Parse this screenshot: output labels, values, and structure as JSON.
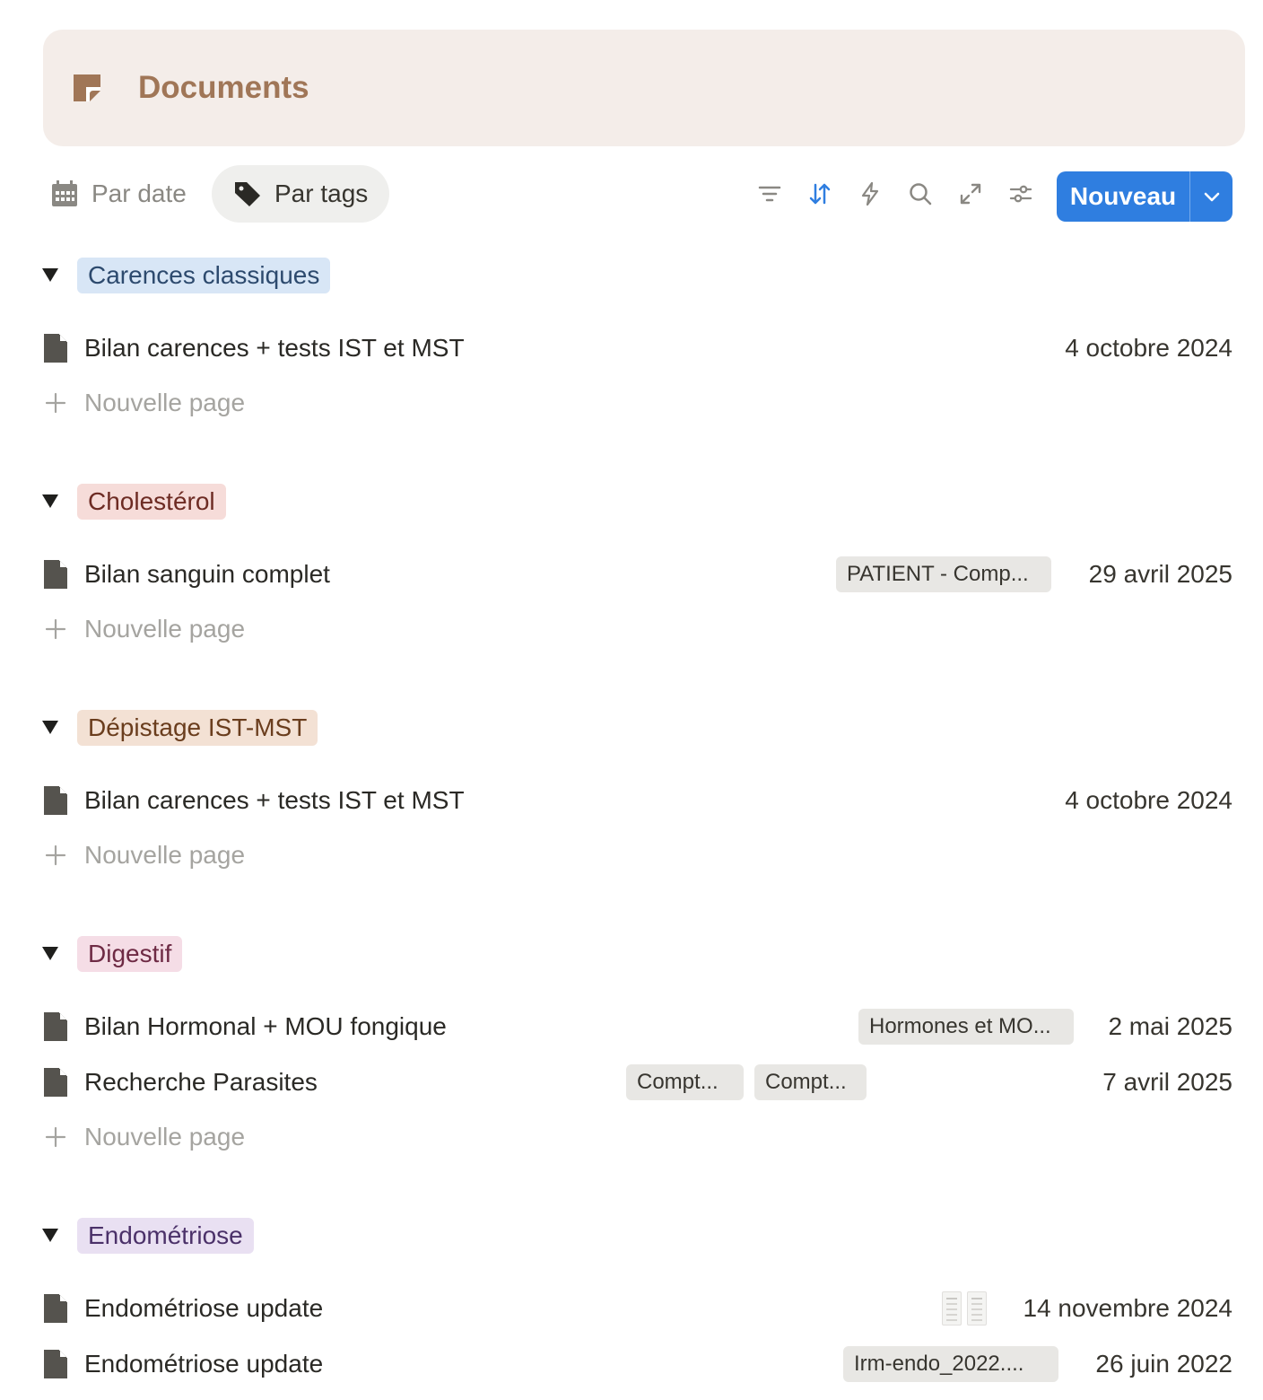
{
  "header": {
    "title": "Documents",
    "icon": "document-icon",
    "background": "#f4ede9",
    "title_color": "#a07657"
  },
  "toolbar": {
    "tab_date": "Par date",
    "tab_tags": "Par tags",
    "active_tab": "Par tags",
    "icons": [
      "filter-icon",
      "sort-icon",
      "automation-icon",
      "search-icon",
      "expand-icon",
      "settings-icon"
    ],
    "new_label": "Nouveau",
    "accent": "#2f7ee0"
  },
  "new_page_label": "Nouvelle page",
  "groups": [
    {
      "tag": "Carences classiques",
      "bg": "#d8e6f6",
      "color": "#2d4a6e",
      "rows": [
        {
          "title": "Bilan carences + tests IST et MST",
          "date": "4 octobre 2024",
          "chips": []
        }
      ]
    },
    {
      "tag": "Cholestérol",
      "bg": "#f6dcd9",
      "color": "#6d2b23",
      "rows": [
        {
          "title": "Bilan sanguin complet",
          "date": "29 avril 2025",
          "chips": [
            "PATIENT - Comp..."
          ]
        }
      ]
    },
    {
      "tag": "Dépistage IST-MST",
      "bg": "#f3e1d4",
      "color": "#6a3d1d",
      "rows": [
        {
          "title": "Bilan carences + tests IST et MST",
          "date": "4 octobre 2024",
          "chips": []
        }
      ]
    },
    {
      "tag": "Digestif",
      "bg": "#f5dde6",
      "color": "#6e2a44",
      "rows": [
        {
          "title": "Bilan Hormonal + MOU fongique",
          "date": "2 mai 2025",
          "chips": [
            "Hormones et MO..."
          ]
        },
        {
          "title": "Recherche Parasites",
          "date": "7 avril 2025",
          "chips": [
            "Compt...",
            "Compt..."
          ]
        }
      ]
    },
    {
      "tag": "Endométriose",
      "bg": "#e9e0f2",
      "color": "#4b3169",
      "rows": [
        {
          "title": "Endométriose update",
          "date": "14 novembre 2024",
          "chips": [],
          "thumbnails": 2
        },
        {
          "title": "Endométriose update",
          "date": "26 juin 2022",
          "chips": [
            "Irm-endo_2022...."
          ]
        }
      ]
    }
  ]
}
